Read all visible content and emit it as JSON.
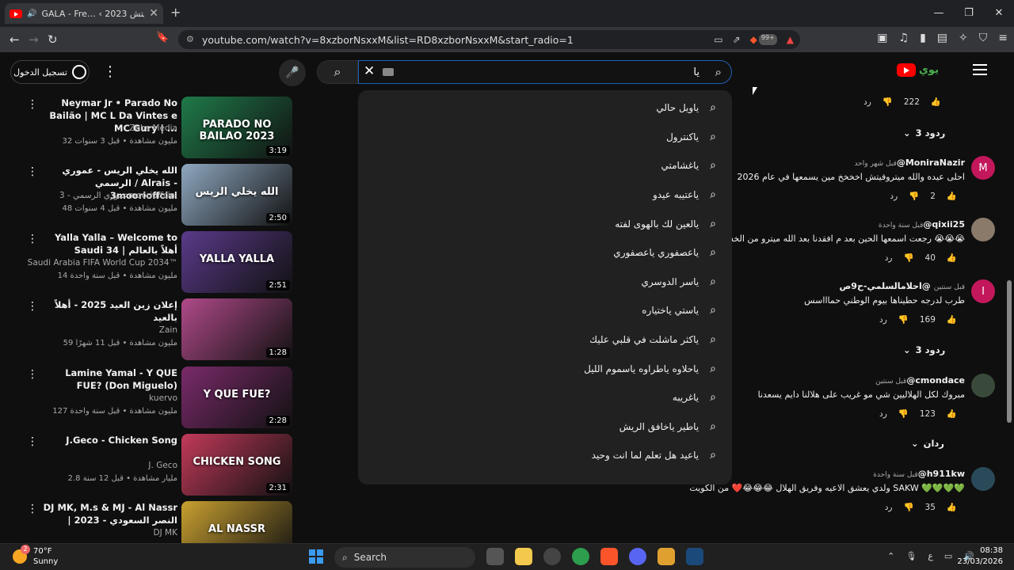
{
  "browser": {
    "tab_title": "GALA - Fre… ‹ متروفيتش 2023",
    "new_tab": "+",
    "url": "youtube.com/watch?v=8xzborNsxxM&list=RD8xzborNsxxM&start_radio=1",
    "brave_badge": "99+"
  },
  "header": {
    "signin_label": "تسجيل الدخول",
    "search_query": "يا",
    "logo_mark": "يوي"
  },
  "suggestions": [
    "ياويل حالي",
    "ياكنترول",
    "ياغشامتي",
    "ياعتيبه عيدو",
    "يالعين لك بالهوى لفته",
    "ياعصفوري ياعصفوري",
    "ياسر الدوسري",
    "ياستي ياختياره",
    "ياكثر ماشلت في قلبي عليك",
    "ياحلاوه ياطراوه ياسموم الليل",
    "ياغريبه",
    "ياطير ياخافق الريش",
    "ياعيد هل تعلم لما انت وحيد"
  ],
  "videos": [
    {
      "title": "Neymar Jr • Parado No Bailão | MC L Da Vintes e MC Gury | ...",
      "channel": "Zbbs Media",
      "meta": "32 مليون مشاهدة • قبل 3 سنوات",
      "duration": "3:19",
      "thumb_text": "PARADO NO BAILAO 2023",
      "color": "#1f7a4a"
    },
    {
      "title": "الله يخلي الريس - عموري الرسمي / Alrais - 3moorioffcial",
      "channel": "عموري الرسمي - 3moorioffcial",
      "meta": "48 مليون مشاهدة • قبل 4 سنوات",
      "duration": "2:50",
      "thumb_text": "الله يخلي الريس",
      "color": "#8fa8c0"
    },
    {
      "title": "Yalla Yalla – Welcome to Saudi 34 | أهلاً بالعالم",
      "channel": "Saudi Arabia FIFA World Cup 2034™",
      "meta": "14 مليون مشاهدة • قبل سنة واحدة",
      "duration": "2:51",
      "thumb_text": "YALLA YALLA",
      "color": "#5a3a8a"
    },
    {
      "title": "إعلان زين العيد 2025 - أهلاً بالعيد",
      "channel": "Zain",
      "meta": "59 مليون مشاهدة • قبل 11 شهرًا",
      "duration": "1:28",
      "thumb_text": "",
      "color": "#b04a8a"
    },
    {
      "title": "Lamine Yamal - Y QUE FUE? (Don Miguelo)",
      "channel": "kuervo",
      "meta": "127 مليون مشاهدة • قبل سنة واحدة",
      "duration": "2:28",
      "thumb_text": "Y QUE FUE?",
      "color": "#7a2a6a"
    },
    {
      "title": "J.Geco - Chicken Song",
      "channel": "J. Geco",
      "meta": "2.8 مليار مشاهدة • قبل 12 سنة",
      "duration": "2:31",
      "thumb_text": "CHICKEN SONG",
      "color": "#c23a5a"
    },
    {
      "title": "DJ MK, M.s & MJ - Al Nassr | النصر السعودي - 2023",
      "channel": "DJ MK",
      "meta": "",
      "duration": "",
      "thumb_text": "AL NASSR",
      "color": "#c9a030"
    }
  ],
  "comments": [
    {
      "name": "@MoniraNazir",
      "time": "قبل شهر واحد",
      "text": "احلى عيده والله ميتروفيتش اخخخخ مين يسمعها في عام 2026",
      "likes": "2",
      "avatar": "M",
      "color": "#c2185b"
    },
    {
      "name": "@qixii25",
      "time": "قبل سنة واحدة",
      "text": "رجعت اسمعها الحين بعد م افقدنا بعد الله ميترو من الخساره 😭😭😭",
      "likes": "40",
      "avatar": "",
      "color": "#8a7a6a"
    },
    {
      "name": "@احلامالسلمي-ح9ص",
      "time": "قبل سنتين",
      "text": "طرب لدرجه حطيناها بيوم الوطني حماااسس",
      "likes": "169",
      "avatar": "I",
      "color": "#c2185b"
    },
    {
      "name": "@cmondace",
      "time": "قبل سنتين",
      "text": "مبروك لكل الهلاليين شي مو غريب على هلالنا دايم يسعدنا",
      "likes": "123",
      "avatar": "",
      "color": "#3a4a3a"
    },
    {
      "name": "@h911kw",
      "time": "قبل سنة واحدة",
      "text": "ولدي يعشق الاعيه وفريق الهلال 😂😂😂❤️ من الكويت SAKW 💚💚💚💚",
      "likes": "35",
      "avatar": "",
      "color": "#2a4a5a"
    }
  ],
  "comment_labels": {
    "reply": "رد",
    "top_likes": "222",
    "replies_3a": "3 ردود",
    "replies_3b": "3 ردود",
    "reply_single": "ردان"
  },
  "taskbar": {
    "temp": "70°F",
    "weather": "Sunny",
    "weather_badge": "2",
    "search": "Search",
    "time": "08:38",
    "date": "23/03/2026",
    "lang": "ع"
  }
}
